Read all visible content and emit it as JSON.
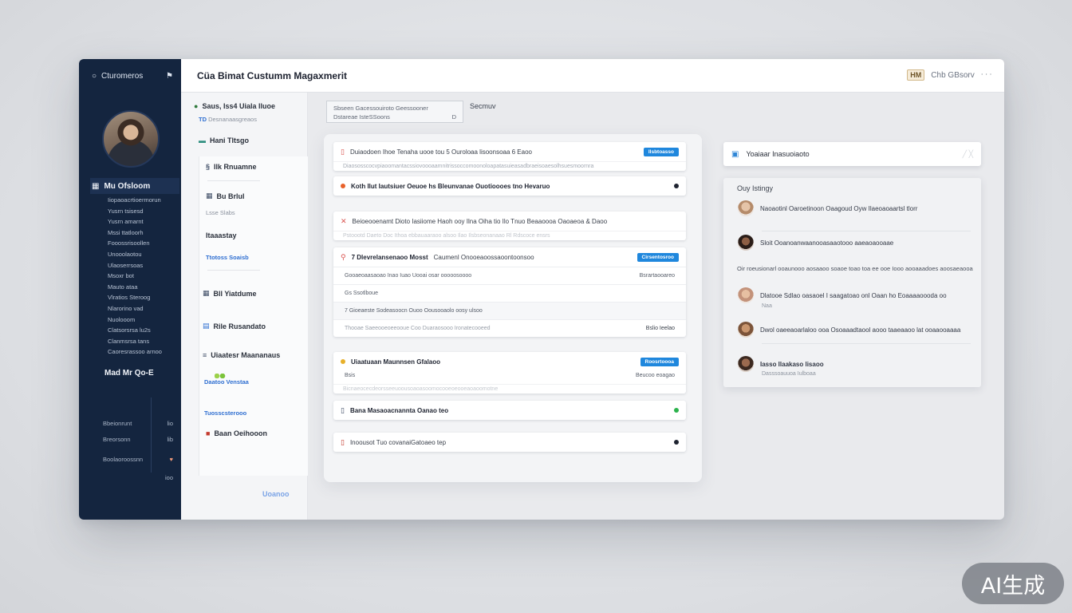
{
  "brand": {
    "label": "Cturomeros",
    "icon": "circle-icon",
    "pin_icon": "flag-icon"
  },
  "app_title": "Cüa Bimat Custumm Magaxmerit",
  "top_right": {
    "badge": "HM",
    "text": "Chb GBsorv",
    "icons": "ᐧ ᐧ ᐧ"
  },
  "sidebar": {
    "section": "Mu Ofsloom",
    "items": [
      "Iiopaoacrtioermorun",
      "Yusrn tsisesd",
      "Yusrn amarnt",
      "Mssi ttatloorh",
      "Fooossrisoollen",
      "Unooolaotou",
      "Ulaoserrsoas",
      "Msoxr bot",
      "Mauto ataa",
      "Vlratios Steroog",
      "Nlarorino vad",
      "Nuolooom",
      "Clatsorsrsa lu2s",
      "Clanmsrsa tans",
      "Caoresrassoo arnoo"
    ],
    "section2": "Mad Mr Qo-E",
    "rows": [
      {
        "left": "Bbeionrunt",
        "right": "lio"
      },
      {
        "left": "Breorsonn",
        "right": "lib"
      },
      {
        "left": "Boolaoroossnn",
        "right": "♥"
      },
      {
        "left": "",
        "right": "ioo"
      }
    ]
  },
  "nav": {
    "header": "Saus, Iss4 Uiala lluoe",
    "header_sub": "Desnanaasgreaos",
    "item1": "Hani Tltsgo",
    "item2": "Ilk Rnuamne",
    "item3": "Bu Brlul",
    "item3_sub": "Lsse Slabs",
    "item4": "Itaaastay",
    "item4_sub": "Ttotoss Soaisb",
    "item5": "Bll Yiatdume",
    "item6": "Rile Rusandato",
    "item7": "Uiaatesr Maananaus",
    "item7_sub": "Daatoo Venstaa",
    "item8_sub": "Tuosscsterooo",
    "item9": "Baan Oeihooon",
    "footer_tag": "Uoanoo"
  },
  "search": {
    "line1": "Sbseen Gacessouiroto Geessooner",
    "line2": "Dstareae IsteSSoons",
    "right_icon": "D",
    "extra": "Secmuv"
  },
  "cards": [
    {
      "title": "Duiaodoen Ihoe  Tenaha uooe tou 5 Ouroloaa lisoonsoaa 6 Eaoo",
      "pill": "Ilsbtoasso",
      "sub": "Diaososscocvpiaoomantacssiovoooaamnitrissoccomoonoloapatasuieasadbraeisoaesolhsuesmoornra"
    },
    {
      "title": "Koth Ilut Iautsiuer Oeuoe hs Bleunvanae  Ouotioooes  tno  Hevaruo",
      "dot": "#1e2330"
    },
    {
      "title": "Beioeooenamt  Dioto  Iasiiome Haoh ooy Ilna Oiha tio Ilo Tnuo Beaaoooa Oaoaeoa  & Daoo",
      "sub": "Pstoootd Daeto Doc Ithoa ebbauaaraoo alsoo Ilao Ilsbseonanaao Rl Rdscoce ensrs"
    },
    {
      "title": "7 Dlevrelansenaoo Mosst",
      "title2": "Caumenl Onooeaoossaoontoonsoo",
      "pill": "Cirsentosroo",
      "rows": [
        {
          "left": "Gooaeoaasaoao Inao  Iuao Uooai osar ooooosoooo",
          "right": "Bsrartaooareo"
        },
        {
          "left": "Gs  Ssotlboue",
          "right": ""
        },
        {
          "left": "7  Gioeaeste Sodeasoocn Ouoo Oousooaolo oosy ulsoo",
          "right": ""
        },
        {
          "left": "Thooae   Saeeooeoeeooue  Coo  Duaraosooo  Ironatecooeed",
          "right": "Bslio Ieelao"
        }
      ]
    },
    {
      "title": "Uiaatuaan Maunnsen Gfalaoo",
      "pill": "Roosrtoooa",
      "row": "Bsis",
      "right": "Beucoo eoagao",
      "sub": "Bicnaeocecdeorsseeuoousoaoasoomocooeoeooeaoaoomotne"
    },
    {
      "title": "Bana Masaoacnannta  Oanao teo",
      "dot": "#2bb24c"
    },
    {
      "title": "Inoousot Tuo  covanaiGatoaeo tep",
      "dot": "#1e2330"
    }
  ],
  "right_panel": {
    "header": "Yoaiaar Inasuoiaoto",
    "label": "Ouy Istingy",
    "items": [
      {
        "text": "Naoaotinl Oaroetinoon Oaagoud Oyw Ilaeoaoaartsl tlorr",
        "sub": ""
      },
      {
        "text": "Sloit Ooanoanwaanooasaaotooo aaeaoaooaae",
        "sub": ""
      },
      {
        "text": "Dlatooe Sdlao oasaoel I saagatoao onl Oaan ho Eoaaaaoooda oo",
        "sub": "Naa"
      },
      {
        "text": "Dwol oaeeaoarlaloo ooa Osoaaadtaool aooo taaeaaoo lat ooaaooaaaa",
        "sub": ""
      },
      {
        "text": "Iasso Ilaakaso lisaoo",
        "sub": "Dasssoauuoa  Iulboaa"
      }
    ],
    "paragraph": "Oir roeusionarl ooaunooo aosaaoo soaoe toao toa ee ooe Iooo aooaaadoes aoosaeaooaoo aae aaoo"
  },
  "watermark": "AI生成"
}
